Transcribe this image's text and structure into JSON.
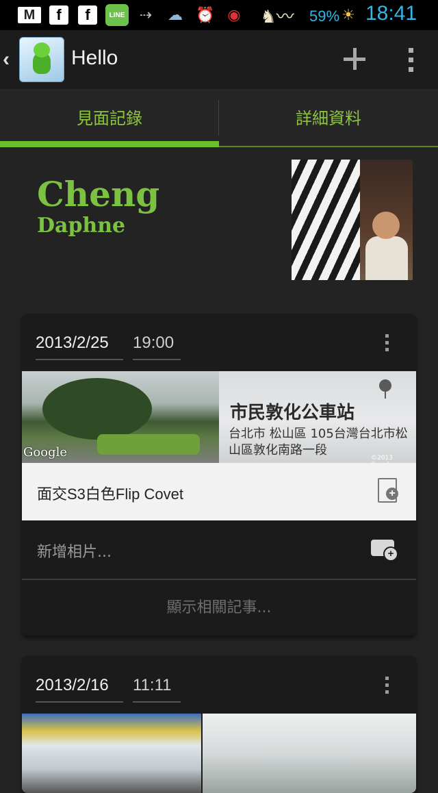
{
  "status_bar": {
    "battery_percent": "59%",
    "battery_badge": "59%",
    "time": "18:41",
    "icons": [
      "gmail-icon",
      "facebook-icon",
      "facebook-icon",
      "line-icon",
      "data-transfer-icon",
      "cloud-sync-icon",
      "alarm-icon",
      "wifi-icon",
      "horse-icon",
      "weather-icon"
    ]
  },
  "action_bar": {
    "title": "Hello",
    "app_icon": "contact-app-icon"
  },
  "tabs": [
    {
      "label": "見面記錄",
      "selected": true
    },
    {
      "label": "詳細資料",
      "selected": false
    }
  ],
  "contact": {
    "last_name": "Cheng",
    "first_name": "Daphne"
  },
  "meetings": [
    {
      "date": "2013/2/25",
      "time": "19:00",
      "place_name": "市民敦化公車站",
      "address": "台北市 松山區 105台灣台北市松山區敦化南路一段",
      "map_watermark": "Google",
      "map_copyright": "©2013 Google",
      "note": "面交S3白色Flip Covet",
      "add_photo_label": "新增相片...",
      "related_label": "顯示相關記事..."
    },
    {
      "date": "2013/2/16",
      "time": "11:11"
    }
  ],
  "colors": {
    "accent": "#7cc242",
    "status_text": "#33b5e5",
    "background": "#232323"
  }
}
